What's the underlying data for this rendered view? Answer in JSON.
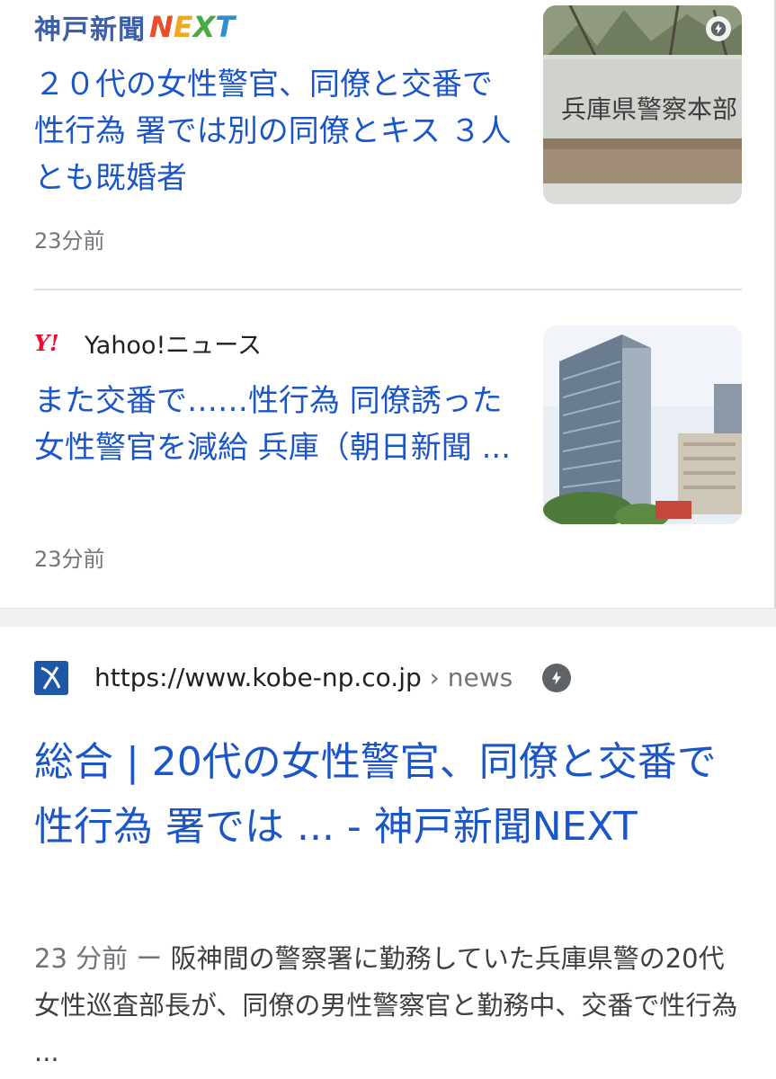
{
  "item1": {
    "source_brand": "神戸新聞",
    "source_next": [
      "N",
      "E",
      "X",
      "T"
    ],
    "title": "２０代の女性警官、同僚と交番で性行為 署では別の同僚とキス ３人とも既婚者",
    "time": "23分前",
    "thumb_icon": "amp-lightning-icon"
  },
  "item2": {
    "source_logo": "Y!",
    "source_name": "Yahoo!ニュース",
    "title": "また交番で……性行為 同僚誘った女性警官を減給 兵庫（朝日新聞 ...",
    "time": "23分前"
  },
  "result": {
    "url": "https://www.kobe-np.co.jp",
    "crumb": " › news",
    "title": "総合 | 20代の女性警官、同僚と交番で性行為 署では ... - 神戸新聞NEXT",
    "snippet_date": "23 分前 ー ",
    "snippet": "阪神間の警察署に勤務していた兵庫県警の20代女性巡査部長が、同僚の男性警察官と勤務中、交番で性行為 ..."
  },
  "colors": {
    "link": "#1a56c8",
    "meta": "#70757a",
    "text": "#3c4043"
  }
}
